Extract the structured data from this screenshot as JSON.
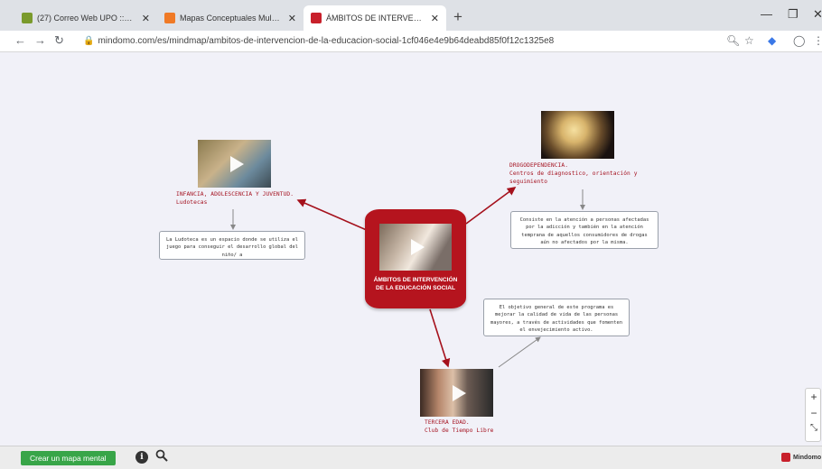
{
  "browser": {
    "tabs": [
      {
        "title": "(27) Correo Web UPO :: Entrada",
        "color": "#7a9a2c"
      },
      {
        "title": "Mapas Conceptuales Multimedia",
        "color": "#f07a26"
      },
      {
        "title": "ÁMBITOS DE INTERVENCIÓN DE LA",
        "color": "#c8202b"
      }
    ],
    "url": "mindomo.com/es/mindmap/ambitos-de-intervencion-de-la-educacion-social-1cf046e4e9b64deabd85f0f12c1325e8"
  },
  "map": {
    "central": {
      "title": "ÁMBITOS DE INTERVENCIÓN DE LA EDUCACIÓN SOCIAL",
      "color": "#b5141e"
    },
    "topics": {
      "infancia": {
        "title": "INFANCIA, ADOLESCENCIA Y JUVENTUD.",
        "subtitle": "Ludotecas",
        "note": "La Ludoteca es un espacio donde se utiliza el juego para conseguir el desarrollo global del niño/ a"
      },
      "drogo": {
        "title": "DROGODEPENDENCIA.",
        "subtitle": "Centros de diagnostico, orientación y seguimiento",
        "note": "Consiste en la atención a personas afectadas por la adicción y también en la atención temprana de aquellos consumidores de drogas aún no afectados por la misma."
      },
      "tercera": {
        "title": "TERCERA EDAD.",
        "subtitle": "Club de Tiempo Libre",
        "note": "El objetivo general de este programa es mejorar la calidad de vida de las personas mayores, a través de actividades que fomenten el envejecimiento activo."
      }
    }
  },
  "bottom": {
    "create_label": "Crear un mapa mental",
    "brand": "Mindomo"
  },
  "icons": [
    "back-icon",
    "forward-icon",
    "reload-icon",
    "lock-icon",
    "search-icon",
    "star-icon",
    "extension-icon",
    "profile-icon",
    "menu-icon",
    "info-icon",
    "zoom-in-icon",
    "zoom-out-icon",
    "fit-screen-icon",
    "play-icon"
  ]
}
